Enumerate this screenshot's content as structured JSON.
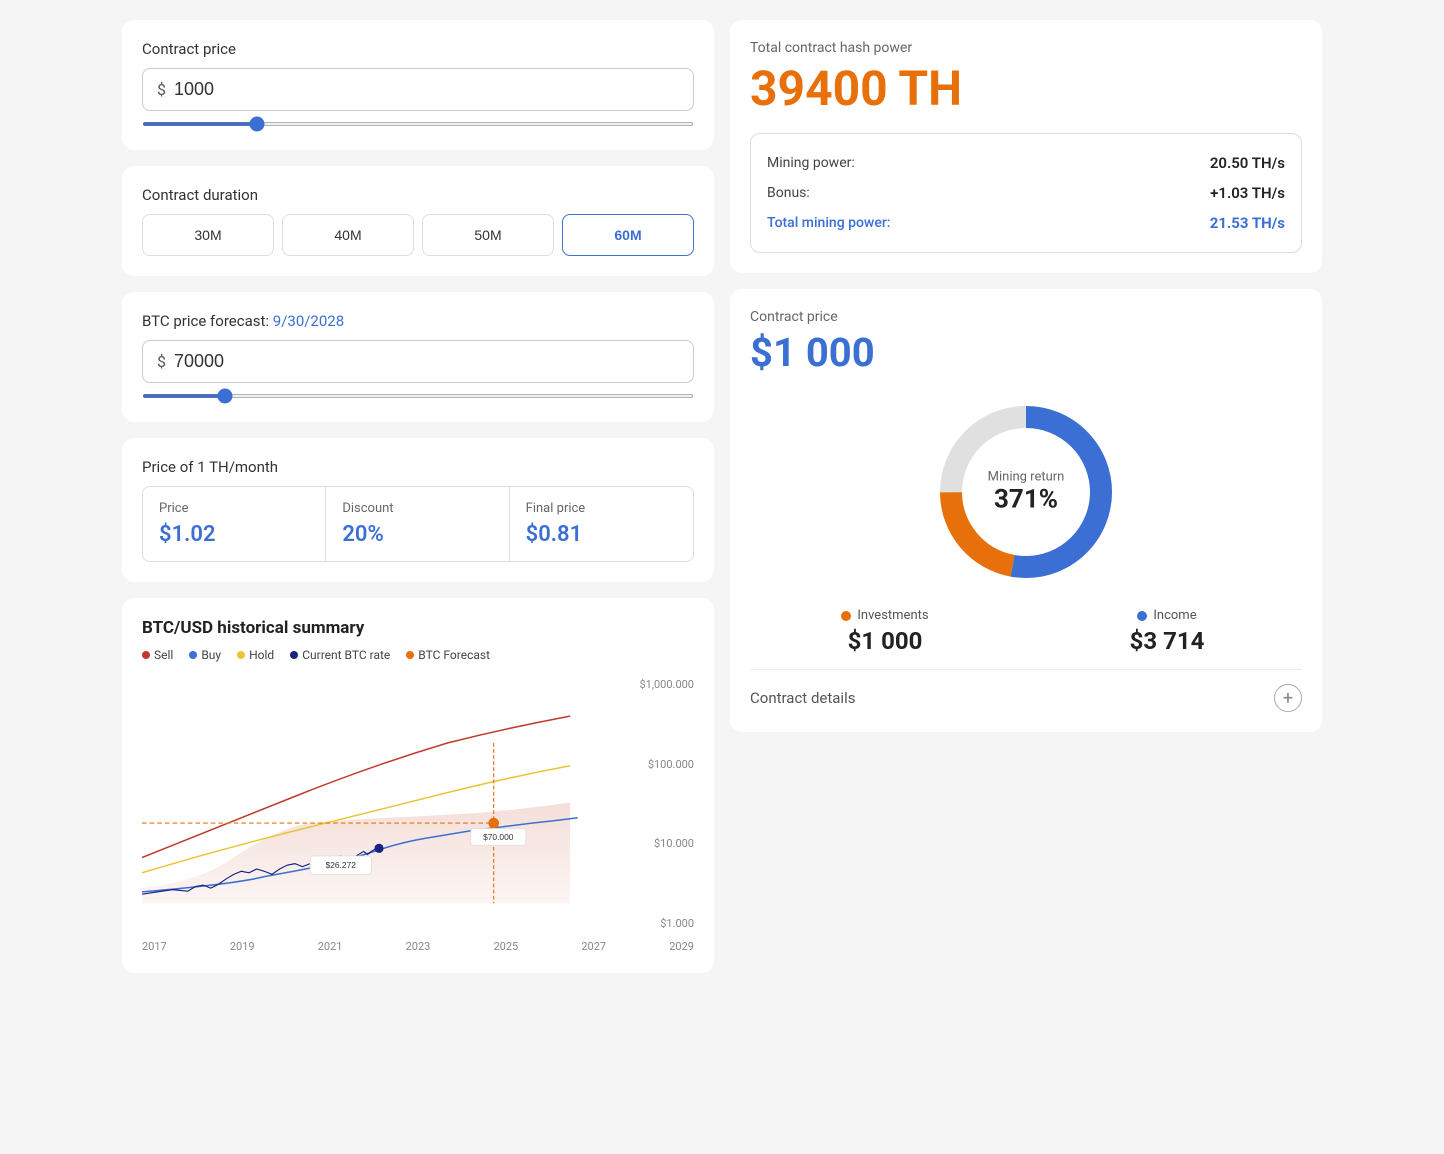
{
  "leftPanel": {
    "contractPrice": {
      "label": "Contract price",
      "currency": "$",
      "value": "1000",
      "sliderMin": 0,
      "sliderMax": 5000,
      "sliderValue": 1000
    },
    "contractDuration": {
      "label": "Contract duration",
      "options": [
        "30M",
        "40M",
        "50M",
        "60M"
      ],
      "active": "60M"
    },
    "btcForecast": {
      "label": "BTC price forecast:",
      "date": "9/30/2028",
      "currency": "$",
      "value": "70000",
      "sliderMin": 0,
      "sliderMax": 500000,
      "sliderValue": 70000
    },
    "thPrice": {
      "label": "Price of 1 TH/month",
      "price": {
        "label": "Price",
        "value": "$1.02"
      },
      "discount": {
        "label": "Discount",
        "value": "20%"
      },
      "finalPrice": {
        "label": "Final price",
        "value": "$0.81"
      }
    },
    "chart": {
      "title": "BTC/USD historical summary",
      "legend": [
        {
          "label": "Sell",
          "color": "#c0392b"
        },
        {
          "label": "Buy",
          "color": "#3b6fd4"
        },
        {
          "label": "Hold",
          "color": "#e8c53a"
        },
        {
          "label": "Current BTC rate",
          "color": "#1a237e"
        },
        {
          "label": "BTC Forecast",
          "color": "#e8700a"
        }
      ],
      "yLabels": [
        "$1,000,000",
        "$100.000",
        "$10.000",
        "$1.000"
      ],
      "xLabels": [
        "2017",
        "2019",
        "2021",
        "2023",
        "2025",
        "2027",
        "2029"
      ],
      "annotations": {
        "currentRate": "$26.272",
        "forecast": "$70.000",
        "forecastPoint": "$70.000"
      }
    }
  },
  "rightPanel": {
    "hashPower": {
      "label": "Total contract hash power",
      "value": "39400 TH"
    },
    "miningInfo": {
      "rows": [
        {
          "label": "Mining power:",
          "value": "20.50 TH/s",
          "type": "normal"
        },
        {
          "label": "Bonus:",
          "value": "+1.03 TH/s",
          "type": "normal"
        },
        {
          "label": "Total mining power:",
          "value": "21.53 TH/s",
          "type": "total"
        }
      ]
    },
    "contractPrice": {
      "label": "Contract price",
      "value": "$1 000"
    },
    "donut": {
      "centerLabel": "Mining return",
      "centerValue": "371%",
      "investColor": "#e8700a",
      "incomeColor": "#3b6fd4",
      "bgColor": "#e0e0e0",
      "investPercent": 22,
      "incomePercent": 78
    },
    "investments": {
      "label": "Investments",
      "value": "$1 000",
      "color": "#e8700a"
    },
    "income": {
      "label": "Income",
      "value": "$3 714",
      "color": "#3b6fd4"
    },
    "contractDetails": {
      "label": "Contract details"
    }
  }
}
